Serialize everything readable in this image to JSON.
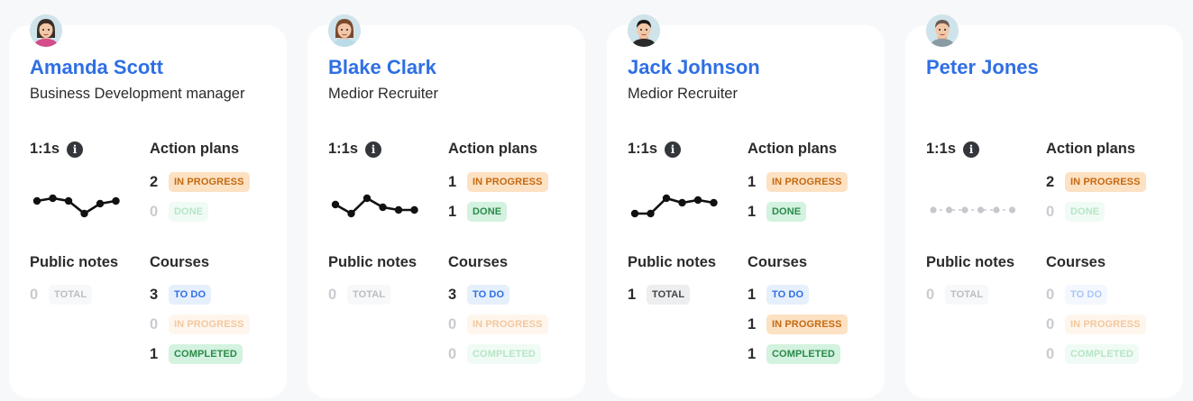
{
  "cards": [
    {
      "name": "Amanda Scott",
      "role": "Business Development manager",
      "one_on_ones_label": "1:1s",
      "action_plans_label": "Action plans",
      "public_notes_label": "Public notes",
      "courses_label": "Courses",
      "action_plans": {
        "in_progress": 2,
        "done": 0,
        "in_progress_label": "IN PROGRESS",
        "done_label": "DONE"
      },
      "public_notes": {
        "total": 0,
        "total_label": "TOTAL"
      },
      "courses": {
        "to_do": 3,
        "in_progress": 0,
        "completed": 1,
        "to_do_label": "TO DO",
        "in_progress_label": "IN PROGRESS",
        "completed_label": "COMPLETED"
      },
      "sparkline": {
        "values": [
          3,
          3.3,
          3,
          1.6,
          2.7,
          3
        ],
        "empty": false
      }
    },
    {
      "name": "Blake Clark",
      "role": "Medior Recruiter",
      "one_on_ones_label": "1:1s",
      "action_plans_label": "Action plans",
      "public_notes_label": "Public notes",
      "courses_label": "Courses",
      "action_plans": {
        "in_progress": 1,
        "done": 1,
        "in_progress_label": "IN PROGRESS",
        "done_label": "DONE"
      },
      "public_notes": {
        "total": 0,
        "total_label": "TOTAL"
      },
      "courses": {
        "to_do": 3,
        "in_progress": 0,
        "completed": 0,
        "to_do_label": "TO DO",
        "in_progress_label": "IN PROGRESS",
        "completed_label": "COMPLETED"
      },
      "sparkline": {
        "values": [
          2.6,
          1.6,
          3.3,
          2.3,
          2.0,
          2.0
        ],
        "empty": false
      }
    },
    {
      "name": "Jack Johnson",
      "role": "Medior Recruiter",
      "one_on_ones_label": "1:1s",
      "action_plans_label": "Action plans",
      "public_notes_label": "Public notes",
      "courses_label": "Courses",
      "action_plans": {
        "in_progress": 1,
        "done": 1,
        "in_progress_label": "IN PROGRESS",
        "done_label": "DONE"
      },
      "public_notes": {
        "total": 1,
        "total_label": "TOTAL"
      },
      "courses": {
        "to_do": 1,
        "in_progress": 1,
        "completed": 1,
        "to_do_label": "TO DO",
        "in_progress_label": "IN PROGRESS",
        "completed_label": "COMPLETED"
      },
      "sparkline": {
        "values": [
          1.6,
          1.6,
          3.3,
          2.8,
          3.1,
          2.8
        ],
        "empty": false
      }
    },
    {
      "name": "Peter Jones",
      "role": "",
      "one_on_ones_label": "1:1s",
      "action_plans_label": "Action plans",
      "public_notes_label": "Public notes",
      "courses_label": "Courses",
      "action_plans": {
        "in_progress": 2,
        "done": 0,
        "in_progress_label": "IN PROGRESS",
        "done_label": "DONE"
      },
      "public_notes": {
        "total": 0,
        "total_label": "TOTAL"
      },
      "courses": {
        "to_do": 0,
        "in_progress": 0,
        "completed": 0,
        "to_do_label": "TO DO",
        "in_progress_label": "IN PROGRESS",
        "completed_label": "COMPLETED"
      },
      "sparkline": {
        "values": [
          2,
          2,
          2,
          2,
          2,
          2
        ],
        "empty": true
      }
    }
  ],
  "colors": {
    "name": "#2f6fe4",
    "sparkline": "#111111",
    "sparkline_empty": "#c5c8cc",
    "in_progress_bg": "#fde1c3",
    "done_bg": "#d3f2df",
    "to_do_bg": "#e6f0fc"
  }
}
